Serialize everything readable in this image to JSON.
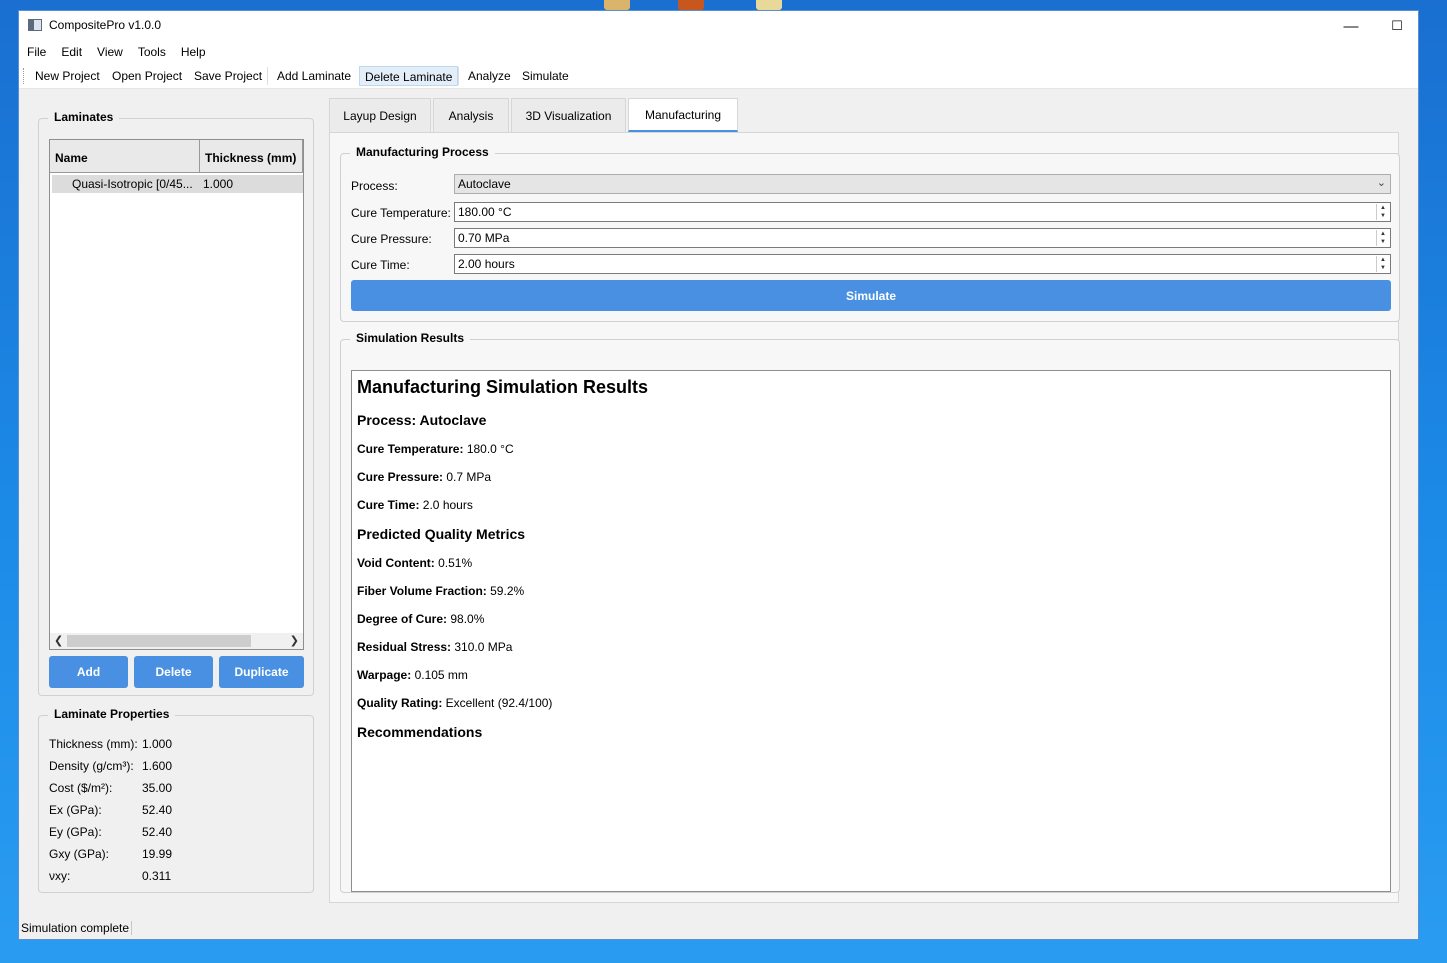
{
  "window": {
    "title": "CompositePro v1.0.0",
    "min_glyph": "—",
    "max_glyph": "☐",
    "close_glyph": "✕"
  },
  "menu": [
    "File",
    "Edit",
    "View",
    "Tools",
    "Help"
  ],
  "toolbar": [
    "New Project",
    "Open Project",
    "Save Project",
    "Add Laminate",
    "Delete Laminate",
    "Analyze",
    "Simulate"
  ],
  "laminates": {
    "title": "Laminates",
    "columns": [
      "Name",
      "Thickness (mm)"
    ],
    "rows": [
      {
        "name": "Quasi-Isotropic [0/45...",
        "thickness": "1.000"
      }
    ],
    "buttons": {
      "add": "Add",
      "delete": "Delete",
      "duplicate": "Duplicate"
    }
  },
  "properties": {
    "title": "Laminate Properties",
    "rows": [
      {
        "label": "Thickness (mm):",
        "value": "1.000"
      },
      {
        "label": "Density (g/cm³):",
        "value": "1.600"
      },
      {
        "label": "Cost ($/m²):",
        "value": "35.00"
      },
      {
        "label": "Ex (GPa):",
        "value": "52.40"
      },
      {
        "label": "Ey (GPa):",
        "value": "52.40"
      },
      {
        "label": "Gxy (GPa):",
        "value": "19.99"
      },
      {
        "label": "νxy:",
        "value": "0.311"
      }
    ]
  },
  "tabs": [
    "Layup Design",
    "Analysis",
    "3D Visualization",
    "Manufacturing"
  ],
  "process": {
    "title": "Manufacturing Process",
    "process_label": "Process:",
    "process_value": "Autoclave",
    "temp_label": "Cure Temperature:",
    "temp_value": "180.00 °C",
    "pressure_label": "Cure Pressure:",
    "pressure_value": "0.70 MPa",
    "time_label": "Cure Time:",
    "time_value": "2.00 hours",
    "simulate": "Simulate"
  },
  "results": {
    "title": "Simulation Results",
    "heading": "Manufacturing Simulation Results",
    "process_heading": "Process: Autoclave",
    "params": [
      {
        "label": "Cure Temperature:",
        "value": " 180.0 °C"
      },
      {
        "label": "Cure Pressure:",
        "value": " 0.7 MPa"
      },
      {
        "label": "Cure Time:",
        "value": " 2.0 hours"
      }
    ],
    "metrics_heading": "Predicted Quality Metrics",
    "metrics": [
      {
        "label": "Void Content:",
        "value": " 0.51%"
      },
      {
        "label": "Fiber Volume Fraction:",
        "value": " 59.2%"
      },
      {
        "label": "Degree of Cure:",
        "value": " 98.0%"
      },
      {
        "label": "Residual Stress:",
        "value": " 310.0 MPa"
      },
      {
        "label": "Warpage:",
        "value": " 0.105 mm"
      },
      {
        "label": "Quality Rating:",
        "value": " Excellent (92.4/100)"
      }
    ],
    "recommendations_heading": "Recommendations"
  },
  "status": {
    "text": "Simulation complete"
  }
}
